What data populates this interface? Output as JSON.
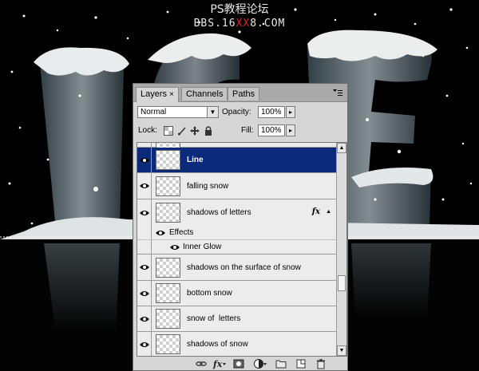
{
  "watermark": {
    "line1": "PS教程论坛",
    "line2_prefix": "BBS.16",
    "line2_mark": "XX",
    "line2_suffix": "8.COM"
  },
  "panel": {
    "tabs": [
      {
        "label": "Layers",
        "active": true,
        "close": "×"
      },
      {
        "label": "Channels",
        "active": false
      },
      {
        "label": "Paths",
        "active": false
      }
    ],
    "menu_icon": "panel-menu-icon",
    "blend_mode": "Normal",
    "opacity_label": "Opacity:",
    "opacity_value": "100%",
    "lock_label": "Lock:",
    "fill_label": "Fill:",
    "fill_value": "100%",
    "selected_color": "#0b2a7a"
  },
  "layers": [
    {
      "name": "Line",
      "selected": true,
      "visible": true
    },
    {
      "name": "falling snow",
      "visible": true
    },
    {
      "name": "shadows of letters",
      "visible": true,
      "fx": "fx"
    },
    {
      "name": "shadows on the surface of snow",
      "visible": true
    },
    {
      "name": "bottom snow",
      "visible": true
    },
    {
      "name": "snow of  letters",
      "visible": true
    },
    {
      "name": "shadows of snow",
      "visible": true
    }
  ],
  "effects": {
    "label": "Effects",
    "items": [
      "Inner Glow"
    ]
  },
  "bottom_icons": [
    "link-icon",
    "fx-icon",
    "mask-icon",
    "adjustment-icon",
    "folder-icon",
    "new-layer-icon",
    "trash-icon"
  ]
}
